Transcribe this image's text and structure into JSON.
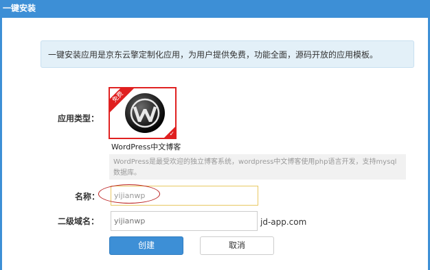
{
  "window": {
    "title": "一键安装"
  },
  "notice": {
    "text": "一键安装应用是京东云擎定制化应用，为用户提供免费，功能全面，源码开放的应用模板。"
  },
  "form": {
    "app_type_label": "应用类型：",
    "app": {
      "badge": "免费",
      "name": "WordPress中文博客",
      "description": "WordPress是最受欢迎的独立博客系统，wordpress中文博客使用php语言开发，支持mysql数据库。",
      "logo_icon": "wordpress-logo-icon",
      "selected": true
    },
    "name_label": "名称：",
    "name_value": "yijianwp",
    "subdomain_label": "二级域名：",
    "subdomain_placeholder": "yijianwp",
    "domain_suffix": "jd-app.com"
  },
  "buttons": {
    "create": "创建",
    "cancel": "取消"
  },
  "colors": {
    "accent": "#3d8fd6",
    "highlight_red": "#e02020",
    "annotation_red": "#b91b1b"
  }
}
